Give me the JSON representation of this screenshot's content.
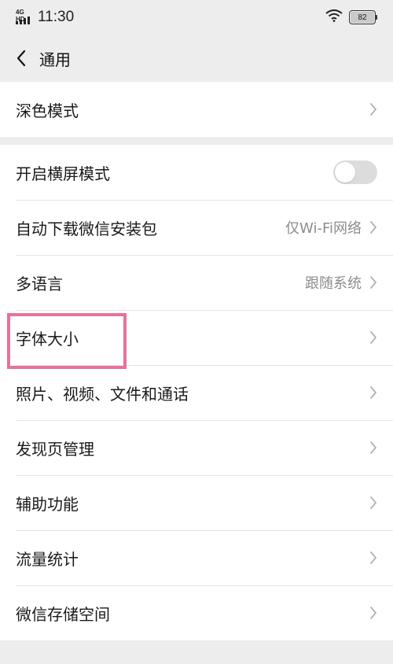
{
  "status_bar": {
    "network": "4G HD",
    "time": "11:30",
    "battery": "82"
  },
  "nav": {
    "title": "通用"
  },
  "group1": {
    "dark_mode": "深色模式"
  },
  "group2": {
    "landscape": "开启横屏模式",
    "auto_download": "自动下载微信安装包",
    "auto_download_value": "仅Wi-Fi网络",
    "language": "多语言",
    "language_value": "跟随系统",
    "font_size": "字体大小",
    "media": "照片、视频、文件和通话",
    "discover": "发现页管理",
    "accessibility": "辅助功能",
    "traffic": "流量统计",
    "storage": "微信存储空间"
  },
  "toggle_state": {
    "landscape_on": false
  },
  "colors": {
    "highlight": "#e8719a",
    "background": "#ededed"
  }
}
